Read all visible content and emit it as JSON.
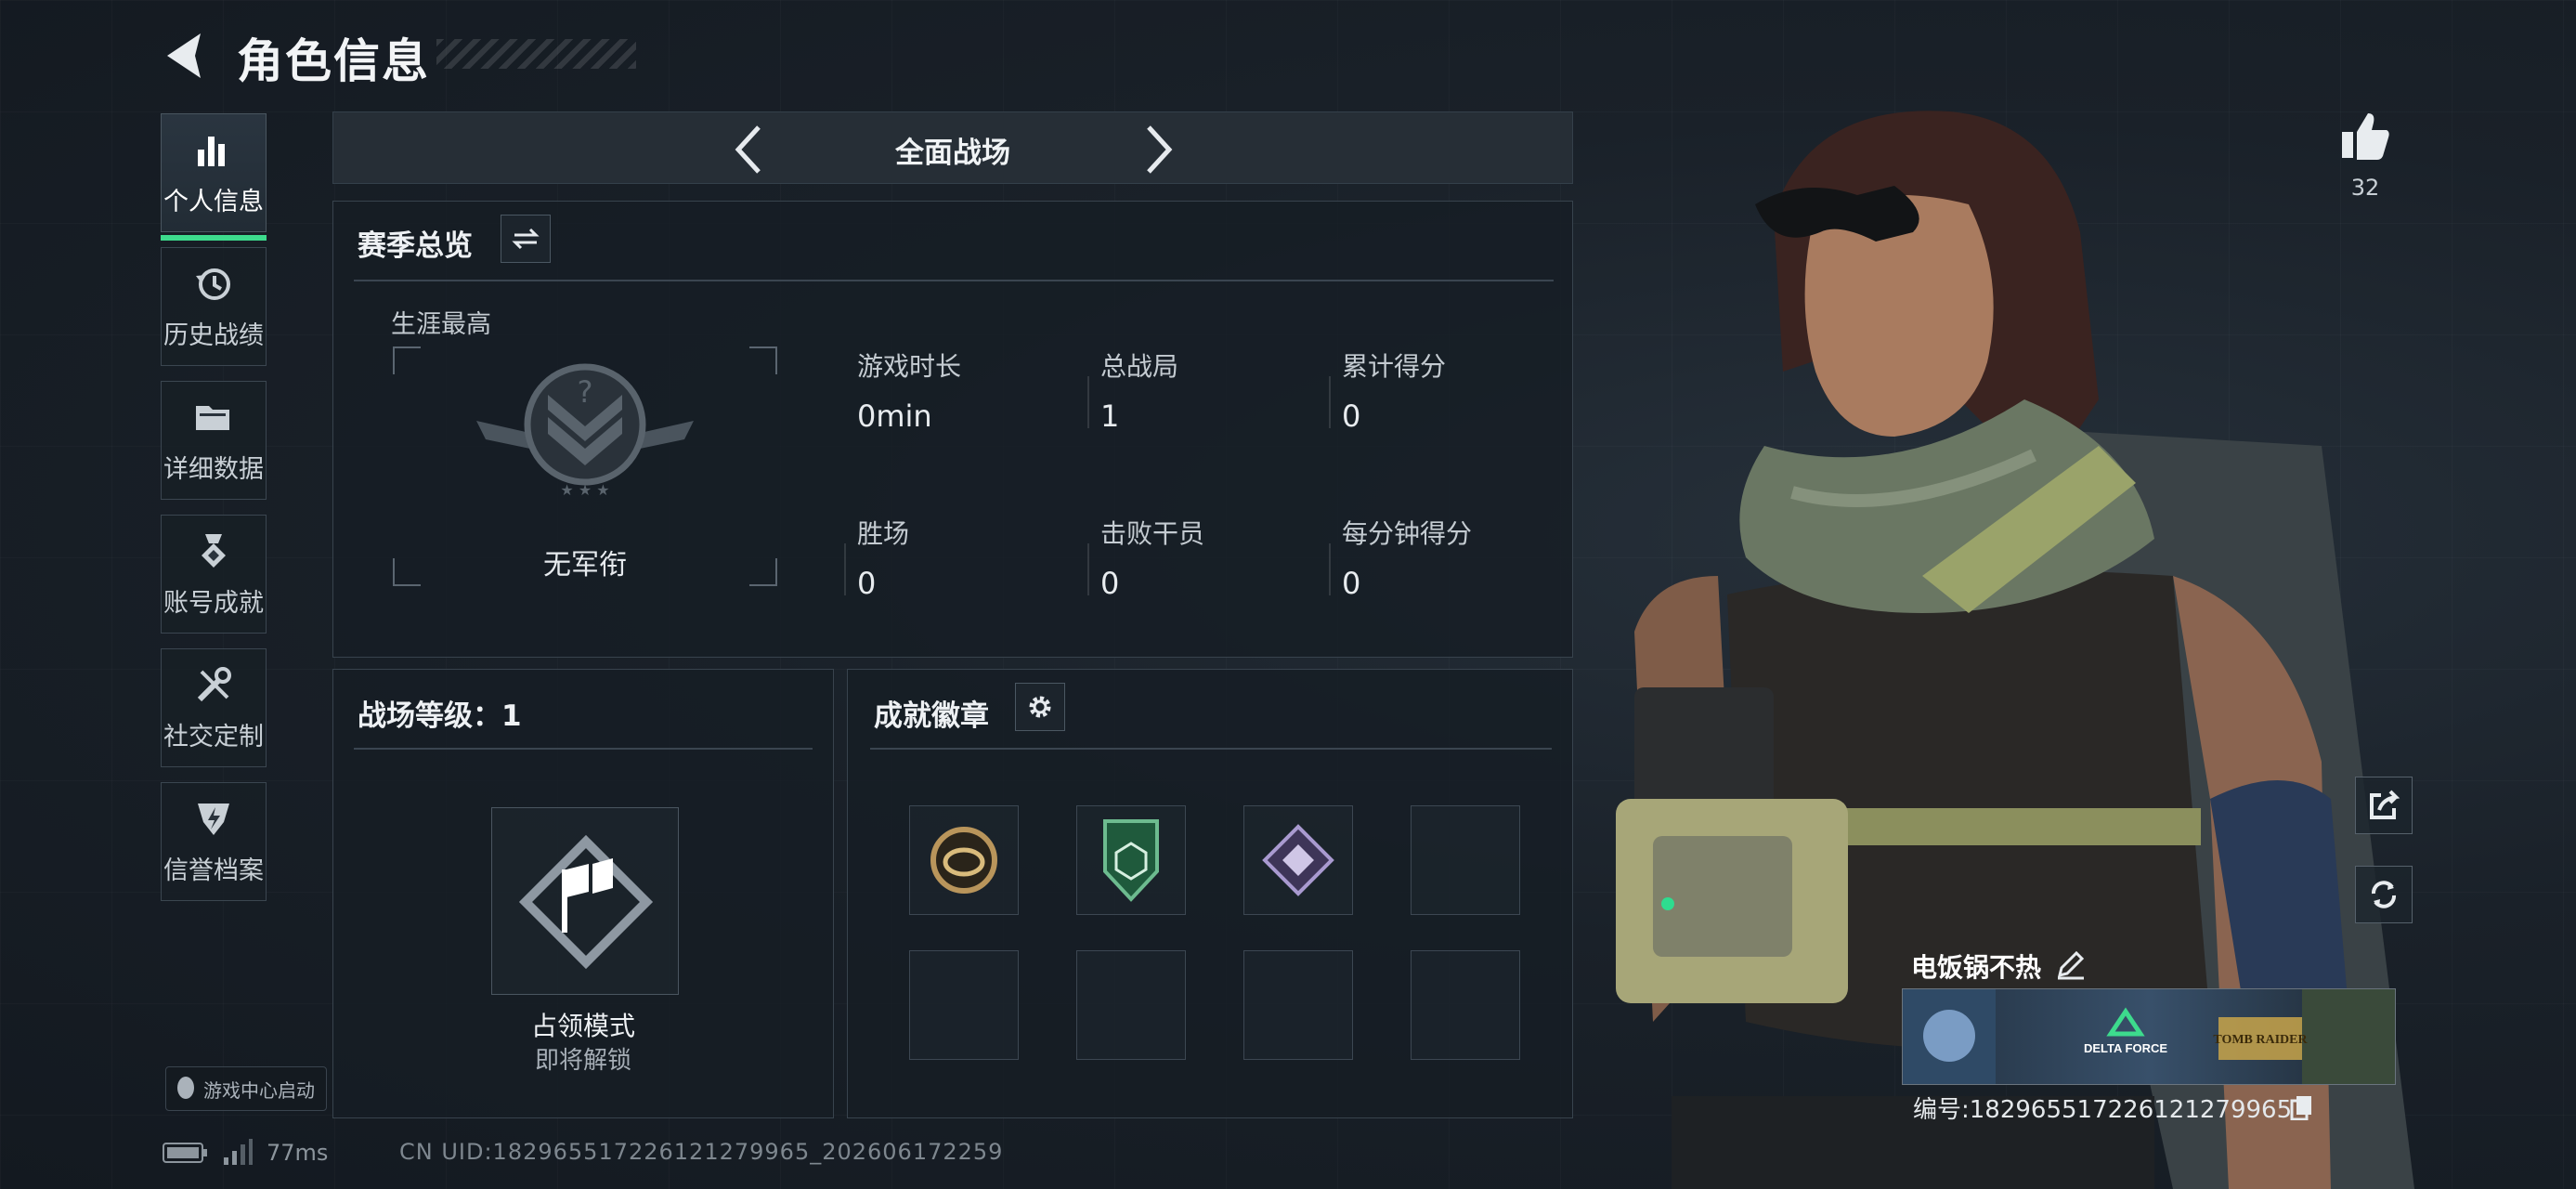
{
  "header": {
    "title": "角色信息",
    "back_icon": "back-arrow-icon"
  },
  "nav": {
    "items": [
      {
        "label": "个人信息",
        "icon": "bar-chart-icon",
        "active": true
      },
      {
        "label": "历史战绩",
        "icon": "history-icon",
        "active": false
      },
      {
        "label": "详细数据",
        "icon": "folder-icon",
        "active": false
      },
      {
        "label": "账号成就",
        "icon": "medal-icon",
        "active": false
      },
      {
        "label": "社交定制",
        "icon": "tools-icon",
        "active": false
      },
      {
        "label": "信誉档案",
        "icon": "shield-bolt-icon",
        "active": false
      }
    ],
    "game_center": "游戏中心启动"
  },
  "status": {
    "ping": "77ms",
    "uid": "CN UID:182965517226121279965_202606172259"
  },
  "mode": {
    "label": "全面战场"
  },
  "season": {
    "title": "赛季总览",
    "career_label": "生涯最高",
    "rank_name": "无军衔",
    "stats": [
      {
        "label": "游戏时长",
        "value": "0min"
      },
      {
        "label": "总战局",
        "value": "1"
      },
      {
        "label": "累计得分",
        "value": "0"
      },
      {
        "label": "胜场",
        "value": "0"
      },
      {
        "label": "击败干员",
        "value": "0"
      },
      {
        "label": "每分钟得分",
        "value": "0"
      }
    ]
  },
  "level": {
    "title": "战场等级：1",
    "mode_name": "占领模式",
    "mode_status": "即将解锁"
  },
  "badges": {
    "title": "成就徽章",
    "settings_icon": "gear-icon",
    "filled": 3,
    "slots": 8
  },
  "profile": {
    "likes": "32",
    "player_name": "电饭锅不热",
    "player_no": "编号:182965517226121279965",
    "banner_logo_1": "DELTA FORCE",
    "banner_logo_2": "TOMB RAIDER"
  },
  "colors": {
    "accent": "#3ddb8d",
    "bg": "#1a2129",
    "panel_border": "#38434d"
  }
}
